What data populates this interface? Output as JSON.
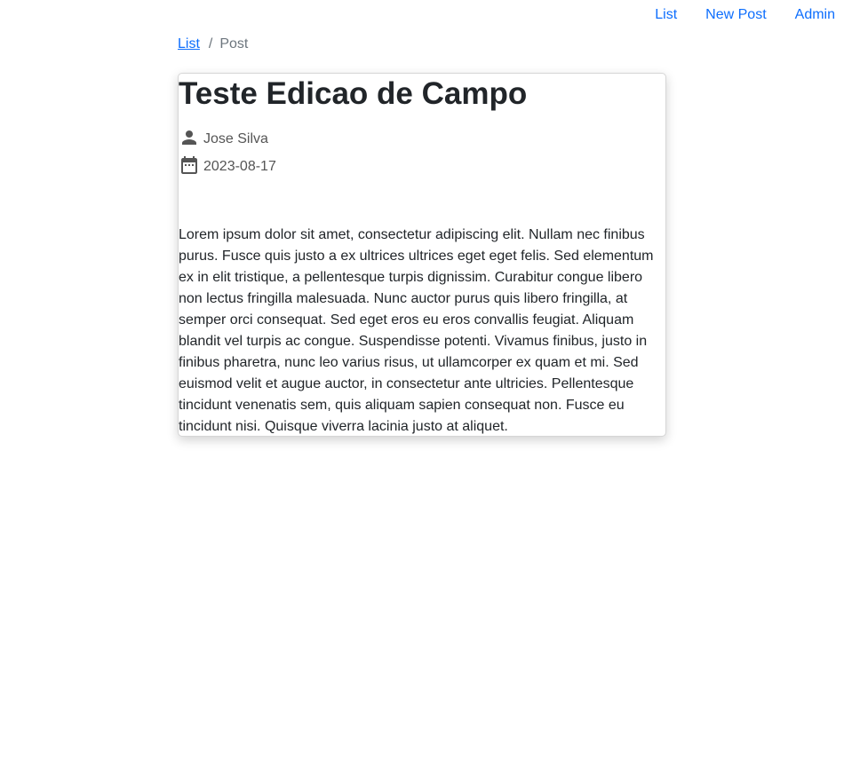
{
  "nav": {
    "items": [
      {
        "label": "List"
      },
      {
        "label": "New Post"
      },
      {
        "label": "Admin"
      }
    ]
  },
  "breadcrumb": {
    "link": "List",
    "separator": "/",
    "current": "Post"
  },
  "post": {
    "title": "Teste Edicao de Campo",
    "author_icon": "person-icon",
    "author": "Jose Silva",
    "date_icon": "calendar-icon",
    "date": "2023-08-17",
    "body": "Lorem ipsum dolor sit amet, consectetur adipiscing elit. Nullam nec finibus purus. Fusce quis justo a ex ultrices ultrices eget eget felis. Sed elementum ex in elit tristique, a pellentesque turpis dignissim. Curabitur congue libero non lectus fringilla malesuada. Nunc auctor purus quis libero fringilla, at semper orci consequat. Sed eget eros eu eros convallis feugiat. Aliquam blandit vel turpis ac congue. Suspendisse potenti. Vivamus finibus, justo in finibus pharetra, nunc leo varius risus, ut ullamcorper ex quam et mi. Sed euismod velit et augue auctor, in consectetur ante ultricies. Pellentesque tincidunt venenatis sem, quis aliquam sapien consequat non. Fusce eu tincidunt nisi. Quisque viverra lacinia justo at aliquet."
  },
  "colors": {
    "link": "#0d6efd",
    "muted": "#6c757d",
    "text": "#212529"
  }
}
